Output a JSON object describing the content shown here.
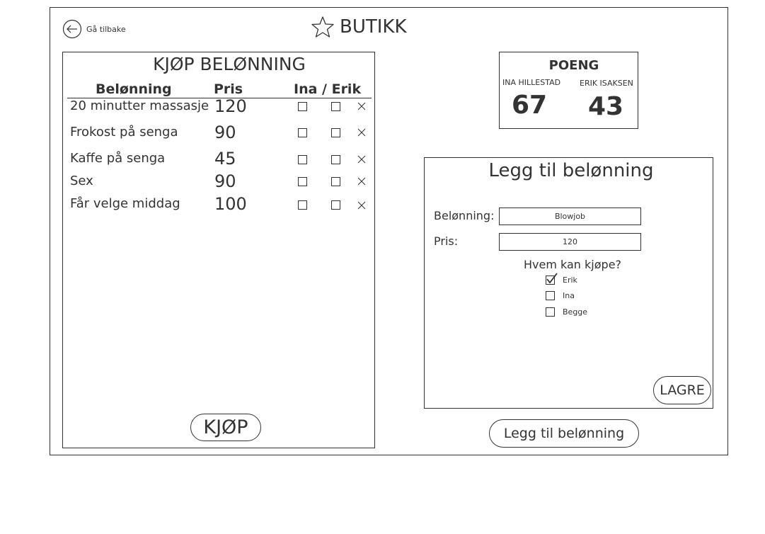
{
  "nav": {
    "back_label": "Gå tilbake"
  },
  "header": {
    "title": "BUTIKK"
  },
  "buy_panel": {
    "title": "KJØP BELØNNING",
    "columns": {
      "reward": "Belønning",
      "price": "Pris",
      "who": "Ina / Erik"
    },
    "rows": [
      {
        "reward": "20 minutter massasje",
        "price": "120"
      },
      {
        "reward": "Frokost på senga",
        "price": "90"
      },
      {
        "reward": "Kaffe på senga",
        "price": "45"
      },
      {
        "reward": "Sex",
        "price": "90"
      },
      {
        "reward": "Får velge middag",
        "price": "100"
      }
    ],
    "buy_label": "KJØP"
  },
  "score": {
    "title": "POENG",
    "ina_name": "INA HILLESTAD",
    "ina_points": "67",
    "erik_name": "ERIK ISAKSEN",
    "erik_points": "43"
  },
  "add_panel": {
    "title": "Legg til belønning",
    "reward_label": "Belønning:",
    "reward_value": "Blowjob",
    "price_label": "Pris:",
    "price_value": "120",
    "who_label": "Hvem kan kjøpe?",
    "options": [
      {
        "label": "Erik",
        "checked": true
      },
      {
        "label": "Ina",
        "checked": false
      },
      {
        "label": "Begge",
        "checked": false
      }
    ],
    "save_label": "LAGRE"
  },
  "add_button_label": "Legg til belønning",
  "icons": {
    "back": "arrow-left-circle-icon",
    "title": "star-icon",
    "remove": "close-icon",
    "check": "checkmark-icon"
  }
}
